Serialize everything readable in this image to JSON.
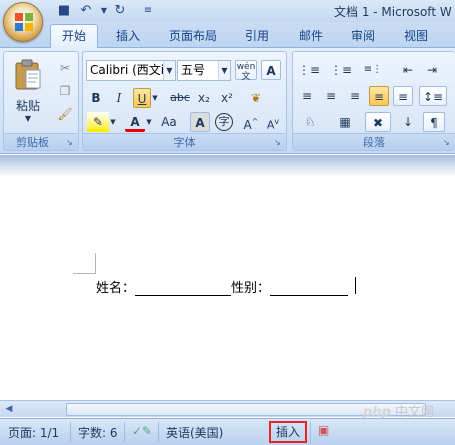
{
  "titlebar": {
    "title": "文档 1 - Microsoft W"
  },
  "tabs": [
    "开始",
    "插入",
    "页面布局",
    "引用",
    "邮件",
    "审阅",
    "视图"
  ],
  "clipboard": {
    "paste_label": "粘贴",
    "group_label": "剪贴板"
  },
  "font": {
    "name": "Calibri (西文i",
    "size": "五号",
    "phonetic_glyph": "wén",
    "group_label": "字体",
    "bold": "B",
    "italic": "I",
    "underline": "U",
    "strike": "abc",
    "sub": "x₂",
    "sup": "x²",
    "clear_format": "Aa",
    "char_border": "A",
    "enclosed": "字",
    "grow": "A",
    "shrink": "A",
    "font_color": "A",
    "char_shade": "A",
    "char_box": "A"
  },
  "paragraph": {
    "group_label": "段落"
  },
  "document": {
    "label_name": "姓名：",
    "label_gender": "性别："
  },
  "statusbar": {
    "page": "页面: 1/1",
    "words": "字数: 6",
    "language": "英语(美国)",
    "insert": "插入"
  },
  "watermark": {
    "php": "php",
    "site": "中文网"
  },
  "colors": {
    "accent_highlight": "#ffc65a",
    "insert_border": "#ee2222"
  }
}
